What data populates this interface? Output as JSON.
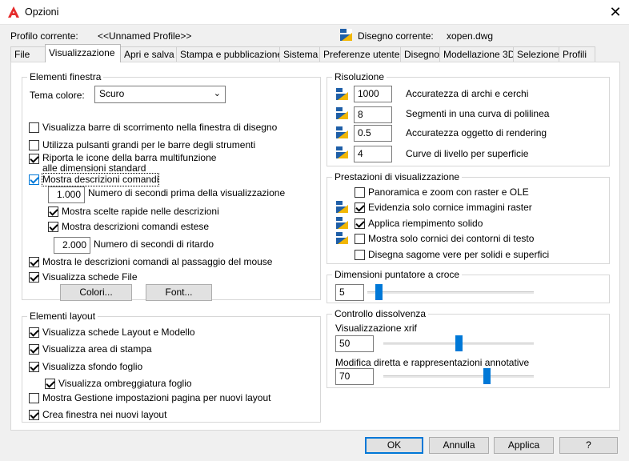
{
  "window": {
    "title": "Opzioni",
    "close": "✕"
  },
  "profile": {
    "label": "Profilo corrente:",
    "value": "<<Unnamed Profile>>",
    "drawing_label": "Disegno corrente:",
    "drawing_value": "xopen.dwg"
  },
  "tabs": [
    "File",
    "Visualizzazione",
    "Apri e salva",
    "Stampa e pubblicazione",
    "Sistema",
    "Preferenze utente",
    "Disegno",
    "Modellazione 3D",
    "Selezione",
    "Profili"
  ],
  "window_elements": {
    "title": "Elementi finestra",
    "theme_label": "Tema colore:",
    "theme_value": "Scuro",
    "scrollbars": "Visualizza barre di scorrimento nella finestra di disegno",
    "large_buttons": "Utilizza pulsanti grandi per le barre degli strumenti",
    "ribbon_icons": "Riporta le icone della barra multifunzione alle dimensioni standard",
    "tooltips": "Mostra descrizioni comandi",
    "tooltip_seconds_value": "1.000",
    "tooltip_seconds_label": "Numero di secondi prima della visualizzazione",
    "shortcut_tips": "Mostra scelte rapide nelle descrizioni",
    "extended_tips": "Mostra descrizioni comandi estese",
    "delay_value": "2.000",
    "delay_label": "Numero di secondi di ritardo",
    "rollover_tips": "Mostra le descrizioni comandi al passaggio del mouse",
    "file_tabs": "Visualizza schede File",
    "colors_button": "Colori...",
    "fonts_button": "Font..."
  },
  "layout_elements": {
    "title": "Elementi layout",
    "layout_tabs": "Visualizza schede Layout e Modello",
    "print_area": "Visualizza area di stampa",
    "paper_bg": "Visualizza sfondo foglio",
    "paper_shadow": "Visualizza ombreggiatura foglio",
    "page_setup": "Mostra Gestione impostazioni pagina per nuovi layout",
    "viewport": "Crea finestra nei nuovi layout"
  },
  "resolution": {
    "title": "Risoluzione",
    "rows": [
      {
        "value": "1000",
        "label": "Accuratezza di archi e cerchi"
      },
      {
        "value": "8",
        "label": "Segmenti in una curva di polilinea"
      },
      {
        "value": "0.5",
        "label": "Accuratezza oggetto di rendering"
      },
      {
        "value": "4",
        "label": "Curve di livello per superficie"
      }
    ]
  },
  "performance": {
    "title": "Prestazioni di visualizzazione",
    "pan_zoom": "Panoramica e zoom con raster e OLE",
    "highlight_frame": "Evidenzia solo cornice immagini raster",
    "solid_fill": "Applica riempimento solido",
    "text_frame": "Mostra solo cornici dei contorni di testo",
    "silhouettes": "Disegna sagome vere per solidi e superfici"
  },
  "crosshair": {
    "title": "Dimensioni puntatore a croce",
    "value": "5",
    "level_fraction": 0.05
  },
  "fade": {
    "title": "Controllo dissolvenza",
    "xref_label": "Visualizzazione xrif",
    "xref_value": "50",
    "xref_fraction": 0.5,
    "inplace_label": "Modifica diretta e rappresentazioni annotative",
    "inplace_value": "70",
    "inplace_fraction": 0.7
  },
  "buttons": {
    "ok": "OK",
    "cancel": "Annulla",
    "apply": "Applica",
    "help": "?"
  },
  "colors": {
    "accent": "#0078d7",
    "logo": "#e52b2b",
    "icon_blue": "#1f5fa8",
    "icon_yellow": "#f2b705"
  }
}
